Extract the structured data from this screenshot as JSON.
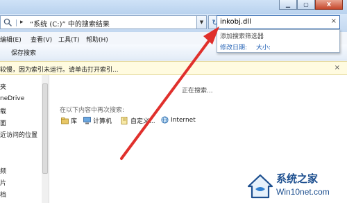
{
  "window": {
    "close_glyph": "X"
  },
  "address": {
    "arrow": "▸",
    "path": "“系统 (C:)” 中的搜索结果",
    "dropdown": "▼",
    "refresh_glyph": "↻"
  },
  "search": {
    "value": "inkobj.dll",
    "clear": "×"
  },
  "menu": {
    "items": [
      {
        "label": "编辑(E)"
      },
      {
        "label": "查看(V)"
      },
      {
        "label": "工具(T)"
      },
      {
        "label": "帮助(H)"
      }
    ]
  },
  "toolbar": {
    "save_search": "保存搜索"
  },
  "filter_dropdown": {
    "title": "添加搜索筛选器",
    "links": [
      {
        "label": "修改日期:"
      },
      {
        "label": "大小:"
      }
    ]
  },
  "infobar": {
    "text": "较慢，因为索引未运行。请单击打开索引...",
    "close": "×"
  },
  "nav": {
    "items": [
      {
        "label": "夹"
      },
      {
        "label": "neDrive"
      },
      {
        "label": "载"
      },
      {
        "label": "面"
      },
      {
        "label": "近访问的位置"
      },
      {
        "label": "频"
      },
      {
        "label": "片"
      },
      {
        "label": "档"
      }
    ]
  },
  "main": {
    "status": "正在搜索...",
    "search_again_label": "在以下内容中再次搜索:",
    "locations": [
      {
        "label": "库",
        "icon": "library-icon"
      },
      {
        "label": "计算机",
        "icon": "computer-icon"
      },
      {
        "label": "自定义...",
        "icon": "custom-folder-icon"
      },
      {
        "label": "Internet",
        "icon": "internet-icon"
      }
    ]
  },
  "colors": {
    "arrow": "#e0302c",
    "link": "#1f5fb4",
    "watermark": "#1d4f8f"
  },
  "watermark": {
    "name": "系统之家",
    "url": "Win10net.com"
  }
}
